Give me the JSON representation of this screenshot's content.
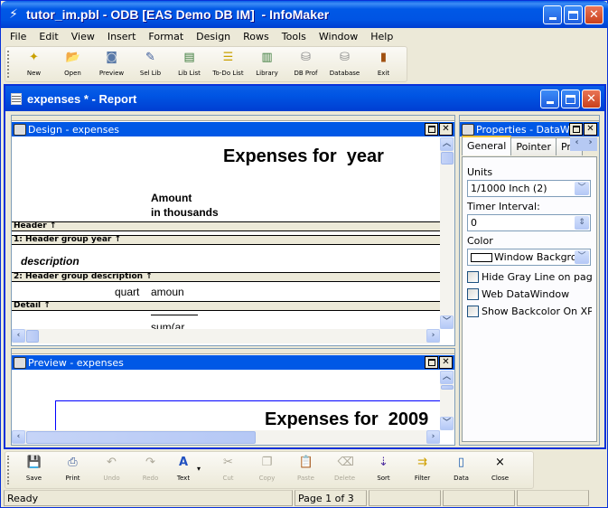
{
  "window": {
    "title": "tutor_im.pbl - ODB [EAS Demo DB IM]  - InfoMaker",
    "app_icon": "infomaker-icon"
  },
  "menu": [
    "File",
    "Edit",
    "View",
    "Insert",
    "Format",
    "Design",
    "Rows",
    "Tools",
    "Window",
    "Help"
  ],
  "toolbar_top": [
    {
      "label": "New",
      "icon": "new-icon",
      "glyph": "✦"
    },
    {
      "label": "Open",
      "icon": "open-folder-icon",
      "glyph": "📂"
    },
    {
      "label": "Preview",
      "icon": "preview-icon",
      "glyph": "◙"
    },
    {
      "label": "Sel Lib",
      "icon": "select-library-icon",
      "glyph": "✎"
    },
    {
      "label": "Lib List",
      "icon": "library-list-icon",
      "glyph": "▤"
    },
    {
      "label": "To-Do List",
      "icon": "todo-list-icon",
      "glyph": "☰"
    },
    {
      "label": "Library",
      "icon": "library-icon",
      "glyph": "▥"
    },
    {
      "label": "DB Prof",
      "icon": "db-profile-icon",
      "glyph": "⛁"
    },
    {
      "label": "Database",
      "icon": "database-icon",
      "glyph": "⛁"
    },
    {
      "label": "Exit",
      "icon": "exit-door-icon",
      "glyph": "▮"
    }
  ],
  "report_window": {
    "title": "expenses * - Report"
  },
  "design_pane": {
    "title": "Design - expenses",
    "report_title": "Expenses for  year",
    "col_header_line1": "Amount",
    "col_header_line2": "in thousands",
    "bands": {
      "header": "Header ↑",
      "group1": "1: Header group year ↑",
      "group2": "2: Header group description ↑",
      "detail": "Detail ↑"
    },
    "description_field": "description",
    "quarter_field": "quart",
    "amount_field": "amoun",
    "sum_field": "sum(ar"
  },
  "preview_pane": {
    "title": "Preview - expenses",
    "report_title": "Expenses for  2009"
  },
  "properties_pane": {
    "title": "Properties -  DataWi",
    "tabs": [
      "General",
      "Pointer",
      "Prin"
    ],
    "units_label": "Units",
    "units_value": "1/1000 Inch (2)",
    "timer_label": "Timer Interval:",
    "timer_value": "0",
    "color_label": "Color",
    "color_value": "Window Backgrou",
    "checkboxes": [
      {
        "label": "Hide Gray Line on page br",
        "checked": false
      },
      {
        "label": "Web DataWindow",
        "checked": false
      },
      {
        "label": "Show Backcolor On XP",
        "checked": false
      }
    ]
  },
  "toolbar_bottom": [
    {
      "label": "Save",
      "icon": "save-icon",
      "glyph": "💾",
      "enabled": true
    },
    {
      "label": "Print",
      "icon": "print-icon",
      "glyph": "⎙",
      "enabled": true
    },
    {
      "label": "Undo",
      "icon": "undo-icon",
      "glyph": "↶",
      "enabled": false
    },
    {
      "label": "Redo",
      "icon": "redo-icon",
      "glyph": "↷",
      "enabled": false
    },
    {
      "label": "Text",
      "icon": "text-icon",
      "glyph": "A",
      "enabled": true
    },
    {
      "label": "Cut",
      "icon": "cut-icon",
      "glyph": "✂",
      "enabled": false
    },
    {
      "label": "Copy",
      "icon": "copy-icon",
      "glyph": "❐",
      "enabled": false
    },
    {
      "label": "Paste",
      "icon": "paste-icon",
      "glyph": "📋",
      "enabled": false
    },
    {
      "label": "Delete",
      "icon": "delete-icon",
      "glyph": "⌫",
      "enabled": false
    },
    {
      "label": "Sort",
      "icon": "sort-az-icon",
      "glyph": "⇣",
      "enabled": true
    },
    {
      "label": "Filter",
      "icon": "filter-icon",
      "glyph": "⇉",
      "enabled": true
    },
    {
      "label": "Data",
      "icon": "data-icon",
      "glyph": "▯",
      "enabled": true
    },
    {
      "label": "Close",
      "icon": "close-icon",
      "glyph": "×",
      "enabled": true
    }
  ],
  "status": {
    "message": "Ready",
    "page": "Page 1 of 3"
  },
  "colors": {
    "title_blue": "#0054e3",
    "pane_title_blue": "#0058e6",
    "face": "#ece9d8",
    "close_red": "#c9401b"
  }
}
